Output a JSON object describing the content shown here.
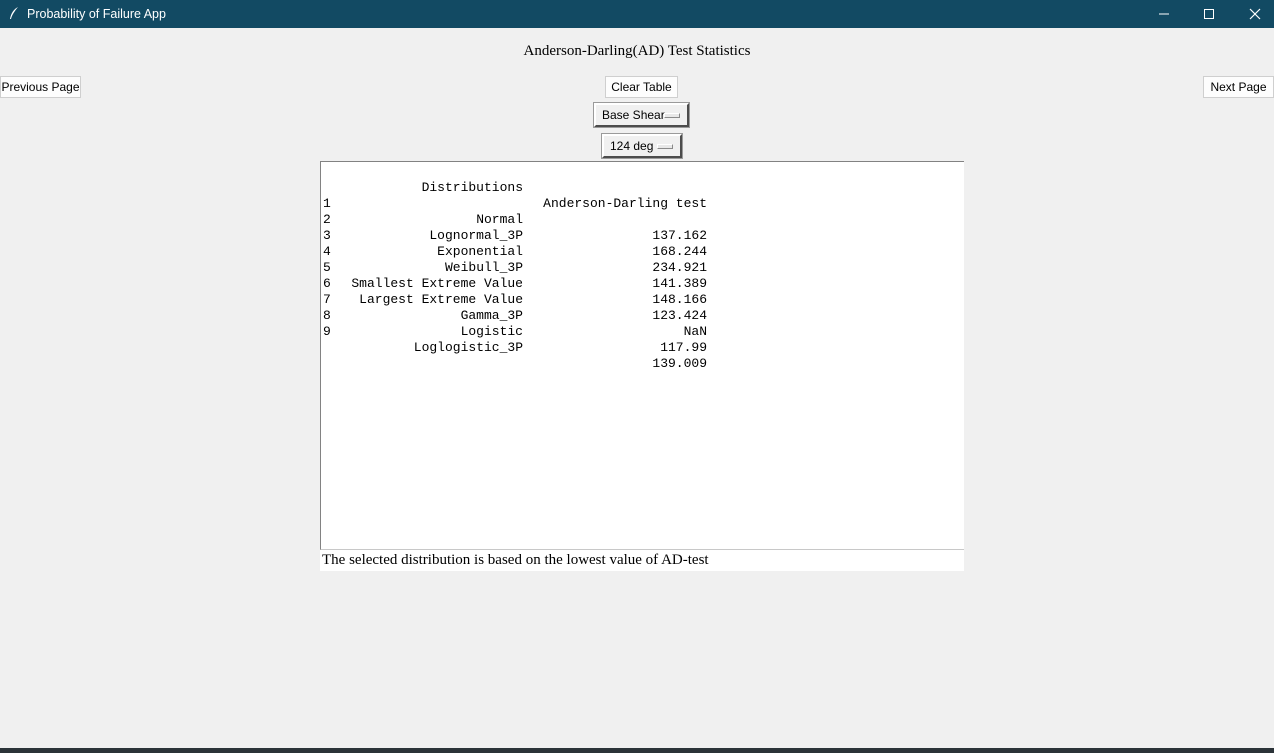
{
  "window": {
    "title": "Probability of Failure App",
    "titlebar_color": "#124a63"
  },
  "heading": "Anderson-Darling(AD) Test Statistics",
  "nav": {
    "previous_label": "Previous Page",
    "next_label": "Next Page",
    "clear_label": "Clear Table"
  },
  "selectors": {
    "quantity": "Base Shear",
    "angle": "124 deg"
  },
  "table": {
    "header_distribution": "Distributions",
    "header_ad": "Anderson-Darling test",
    "rows": [
      {
        "index": "1",
        "distribution": "Normal",
        "ad": "137.162"
      },
      {
        "index": "2",
        "distribution": "Lognormal_3P",
        "ad": "168.244"
      },
      {
        "index": "3",
        "distribution": "Exponential",
        "ad": "234.921"
      },
      {
        "index": "4",
        "distribution": "Weibull_3P",
        "ad": "141.389"
      },
      {
        "index": "5",
        "distribution": "Smallest Extreme Value",
        "ad": "148.166"
      },
      {
        "index": "6",
        "distribution": "Largest Extreme Value",
        "ad": "123.424"
      },
      {
        "index": "7",
        "distribution": "Gamma_3P",
        "ad": "NaN"
      },
      {
        "index": "8",
        "distribution": "Logistic",
        "ad": "117.99"
      },
      {
        "index": "9",
        "distribution": "Loglogistic_3P",
        "ad": "139.009"
      }
    ]
  },
  "footer_note": "The selected distribution is based on the lowest value of AD-test"
}
